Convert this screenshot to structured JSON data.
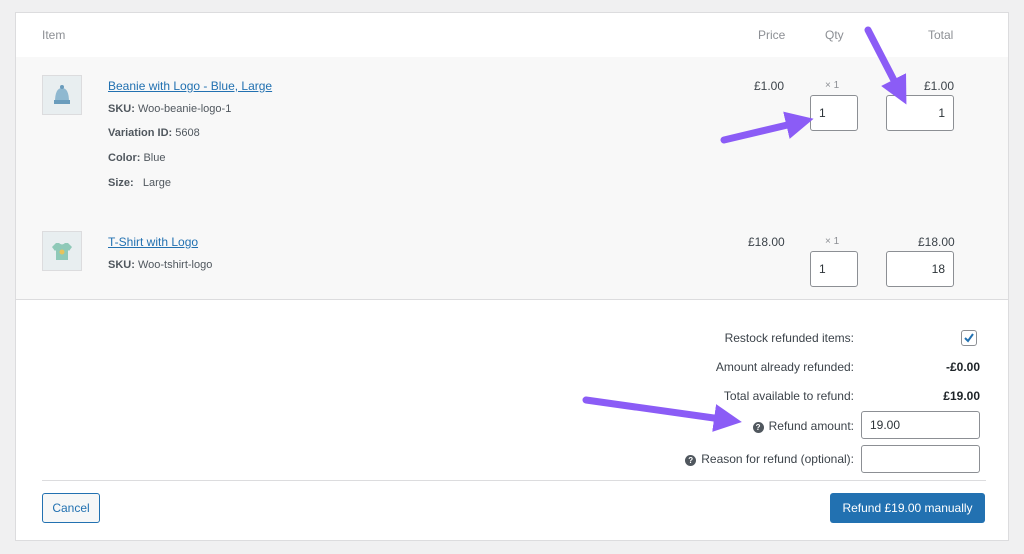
{
  "header": {
    "item": "Item",
    "price": "Price",
    "qty": "Qty",
    "total": "Total"
  },
  "items": [
    {
      "name": "Beanie with Logo - Blue, Large",
      "sku_label": "SKU:",
      "sku": "Woo-beanie-logo-1",
      "variation_label": "Variation ID:",
      "variation": "5608",
      "color_label": "Color:",
      "color": "Blue",
      "size_label": "Size:",
      "size": "Large",
      "price": "£1.00",
      "qty_text": "× 1",
      "total": "£1.00",
      "refund_qty": "1",
      "refund_total": "1"
    },
    {
      "name": "T-Shirt with Logo",
      "sku_label": "SKU:",
      "sku": "Woo-tshirt-logo",
      "price": "£18.00",
      "qty_text": "× 1",
      "total": "£18.00",
      "refund_qty": "1",
      "refund_total": "18"
    }
  ],
  "refund": {
    "restock_label": "Restock refunded items:",
    "restock_checked": true,
    "already_label": "Amount already refunded:",
    "already_value": "-£0.00",
    "available_label": "Total available to refund:",
    "available_value": "£19.00",
    "amount_label": "Refund amount:",
    "amount_value": "19.00",
    "reason_label": "Reason for refund (optional):",
    "reason_value": ""
  },
  "actions": {
    "cancel": "Cancel",
    "refund_manual": "Refund £19.00 manually"
  },
  "colors": {
    "accent": "#2271b1",
    "arrow": "#8b5cf6"
  }
}
